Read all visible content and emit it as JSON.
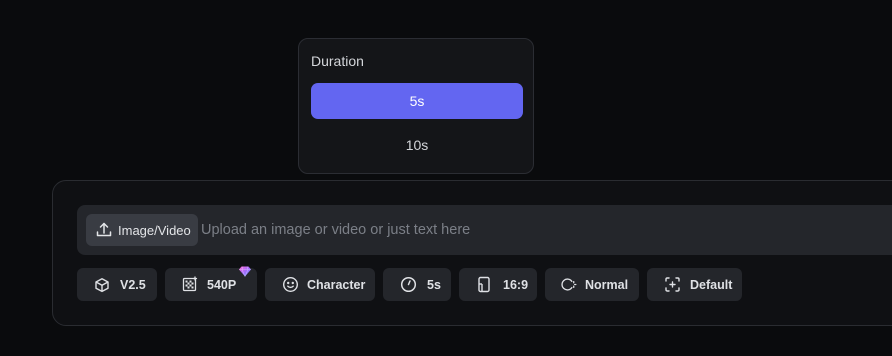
{
  "duration_popover": {
    "title": "Duration",
    "options": [
      "5s",
      "10s"
    ],
    "selected": "5s",
    "accent_color": "#6366f1"
  },
  "composer": {
    "upload_button_label": "Image/Video",
    "upload_icon": "upload-icon",
    "prompt_placeholder": "Upload an image or video or just text here",
    "prompt_value": "",
    "chips": {
      "version": {
        "label": "V2.5",
        "icon": "cube-icon"
      },
      "resolution": {
        "label": "540P",
        "icon": "resolution-icon",
        "badge_icon": "gem-icon"
      },
      "character": {
        "label": "Character",
        "icon": "smiley-icon"
      },
      "duration": {
        "label": "5s",
        "icon": "clock-icon"
      },
      "aspect_ratio": {
        "label": "16:9",
        "icon": "phone-frame-icon"
      },
      "mode": {
        "label": "Normal",
        "icon": "motion-icon"
      },
      "camera": {
        "label": "Default",
        "icon": "camera-target-icon"
      }
    }
  }
}
